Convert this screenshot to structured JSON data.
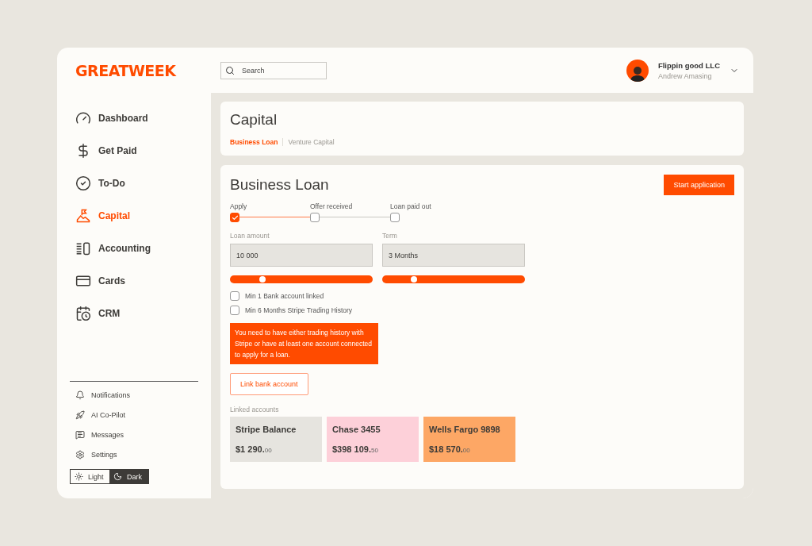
{
  "logo": "GREATWEEK",
  "search": {
    "placeholder": "Search"
  },
  "account": {
    "company": "Flippin good LLC",
    "user": "Andrew Amasing"
  },
  "sidebar": {
    "items": [
      {
        "label": "Dashboard",
        "selected": false
      },
      {
        "label": "Get Paid",
        "selected": false
      },
      {
        "label": "To-Do",
        "selected": false
      },
      {
        "label": "Capital",
        "selected": true
      },
      {
        "label": "Accounting",
        "selected": false
      },
      {
        "label": "Cards",
        "selected": false
      },
      {
        "label": "CRM",
        "selected": false
      }
    ],
    "secondary": [
      "Notifications",
      "AI Co-Pilot",
      "Messages",
      "Settings"
    ],
    "theme": [
      {
        "label": "Light",
        "selected": true
      },
      {
        "label": "Dark",
        "selected": false
      }
    ]
  },
  "header_card": {
    "title": "Capital",
    "tabs": [
      {
        "label": "Business Loan",
        "selected": true
      },
      {
        "label": "Venture Capital",
        "selected": false
      }
    ]
  },
  "loan": {
    "title": "Business Loan",
    "button": "Start application",
    "steps": [
      {
        "label": "Apply",
        "checked": true
      },
      {
        "label": "Offer received",
        "checked": false
      },
      {
        "label": "Loan paid out",
        "checked": false
      }
    ],
    "fields": [
      {
        "label": "Loan amount",
        "value": "10 000",
        "level": 0.23
      },
      {
        "label": "Term",
        "value": "3 Months",
        "level": 0.22
      }
    ],
    "requirements": [
      {
        "label": "Min 1 Bank account linked",
        "checked": false
      },
      {
        "label": "Min 6 Months Stripe Trading History",
        "checked": false
      }
    ],
    "alert": "You need to have either trading history with Stripe or have at least one account connected to apply for a loan.",
    "link_button": "Link bank account",
    "accounts_label": "Linked accounts",
    "accounts": [
      {
        "name": "Stripe Balance",
        "amount": "$1 290.",
        "cents": "00",
        "color": "#e6e4df"
      },
      {
        "name": "Chase 3455",
        "amount": "$398 109.",
        "cents": "50",
        "color": "#fdd0d9"
      },
      {
        "name": "Wells Fargo 9898",
        "amount": "$18 570.",
        "cents": "00",
        "color": "#fda765"
      }
    ]
  }
}
